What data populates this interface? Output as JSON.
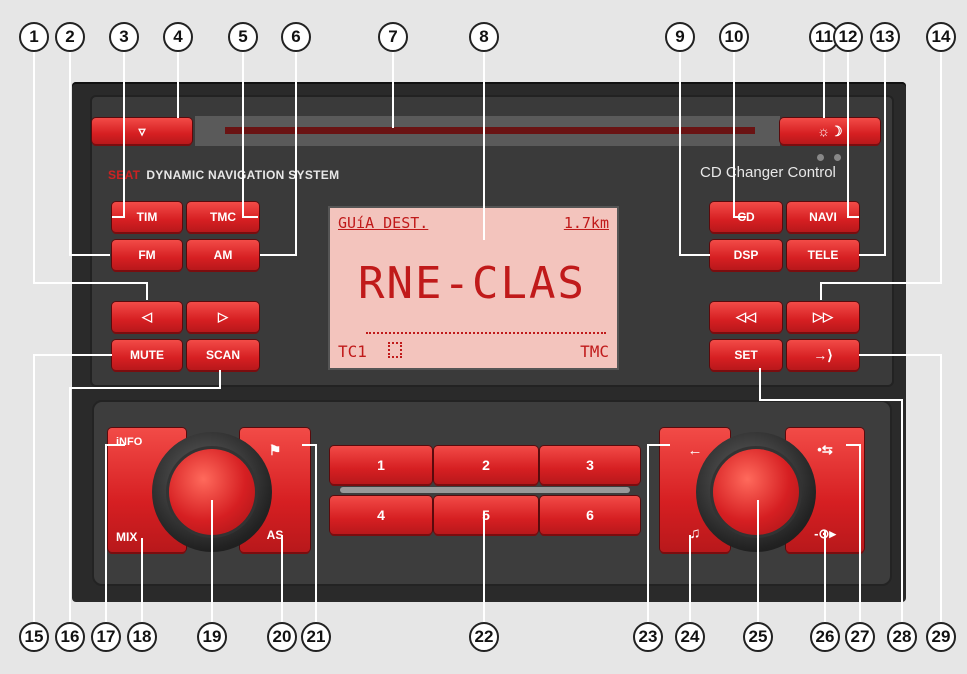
{
  "callouts": [
    "1",
    "2",
    "3",
    "4",
    "5",
    "6",
    "7",
    "8",
    "9",
    "10",
    "11",
    "12",
    "13",
    "14",
    "15",
    "16",
    "17",
    "18",
    "19",
    "20",
    "21",
    "22",
    "23",
    "24",
    "25",
    "26",
    "27",
    "28",
    "29"
  ],
  "brand": {
    "logo": "SEAT",
    "name": "DYNAMIC NAVIGATION SYSTEM"
  },
  "cd_changer_label": "CD Changer Control",
  "display": {
    "top_left": "GUíA DEST.",
    "top_right": "1.7km",
    "station": "RNE-CLAS",
    "bottom_left": "TC1",
    "bottom_right": "TMC"
  },
  "buttons": {
    "eject": "▿",
    "tim": "TIM",
    "tmc": "TMC",
    "fm": "FM",
    "am": "AM",
    "seek_left": "◁",
    "seek_right": "▷",
    "mute": "MUTE",
    "scan": "SCAN",
    "cd": "CD",
    "navi": "NAVI",
    "dsp": "DSP",
    "tele": "TELE",
    "rew": "◁◁",
    "fwd": "▷▷",
    "set": "SET",
    "enter": "→⟩",
    "day_night": "☼☽",
    "info": "iNFO",
    "mix": "MIX",
    "flag": "⚑",
    "as": "AS",
    "presets": [
      "1",
      "2",
      "3",
      "4",
      "5",
      "6"
    ],
    "back": "←",
    "music": "♫",
    "route": "•⇆",
    "dest": "-⊙▸"
  }
}
